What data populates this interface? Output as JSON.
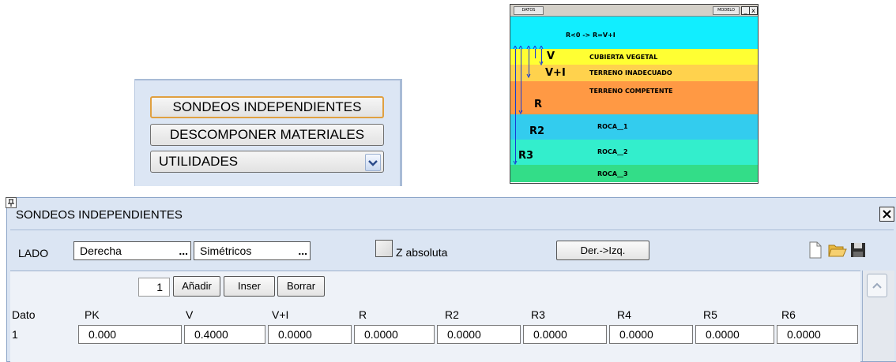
{
  "menu": {
    "items": [
      "SONDEOS INDEPENDIENTES",
      "DESCOMPONER MATERIALES"
    ],
    "select_value": "UTILIDADES"
  },
  "diagram": {
    "title": "DATOS",
    "title_right": "MODELO",
    "formula": "R<0 -> R=V+I",
    "layers": [
      {
        "label": "CUBIERTA VEGETAL",
        "color": "#ffff33"
      },
      {
        "label": "TERRENO INADECUADO",
        "color": "#ffd24d"
      },
      {
        "label": "TERRENO COMPETENTE",
        "color": "#ff9944"
      },
      {
        "label": "ROCA__1",
        "color": "#33ccee"
      },
      {
        "label": "ROCA__2",
        "color": "#33eecc"
      },
      {
        "label": "ROCA__3",
        "color": "#33dd88"
      }
    ],
    "markers": [
      "V",
      "V+I",
      "R",
      "R2",
      "R3"
    ],
    "top_color": "#11eeff"
  },
  "window": {
    "pin": "†",
    "title": "SONDEOS INDEPENDIENTES",
    "close": "X",
    "lado_label": "LADO",
    "side_value": "Derecha",
    "mode_value": "Simétricos",
    "dots": "...",
    "zabs_label": "Z absoluta",
    "mirror_button": "Der.->Izq.",
    "counter": "1",
    "add_button": "Añadir",
    "insert_button": "Inser",
    "delete_button": "Borrar",
    "columns": [
      "Dato",
      "PK",
      "V",
      "V+I",
      "R",
      "R2",
      "R3",
      "R4",
      "R5",
      "R6"
    ],
    "row": {
      "dato": "1",
      "values": [
        "0.000",
        "0.4000",
        "0.0000",
        "0.0000",
        "0.0000",
        "0.0000",
        "0.0000",
        "0.0000",
        "0.0000"
      ]
    }
  }
}
